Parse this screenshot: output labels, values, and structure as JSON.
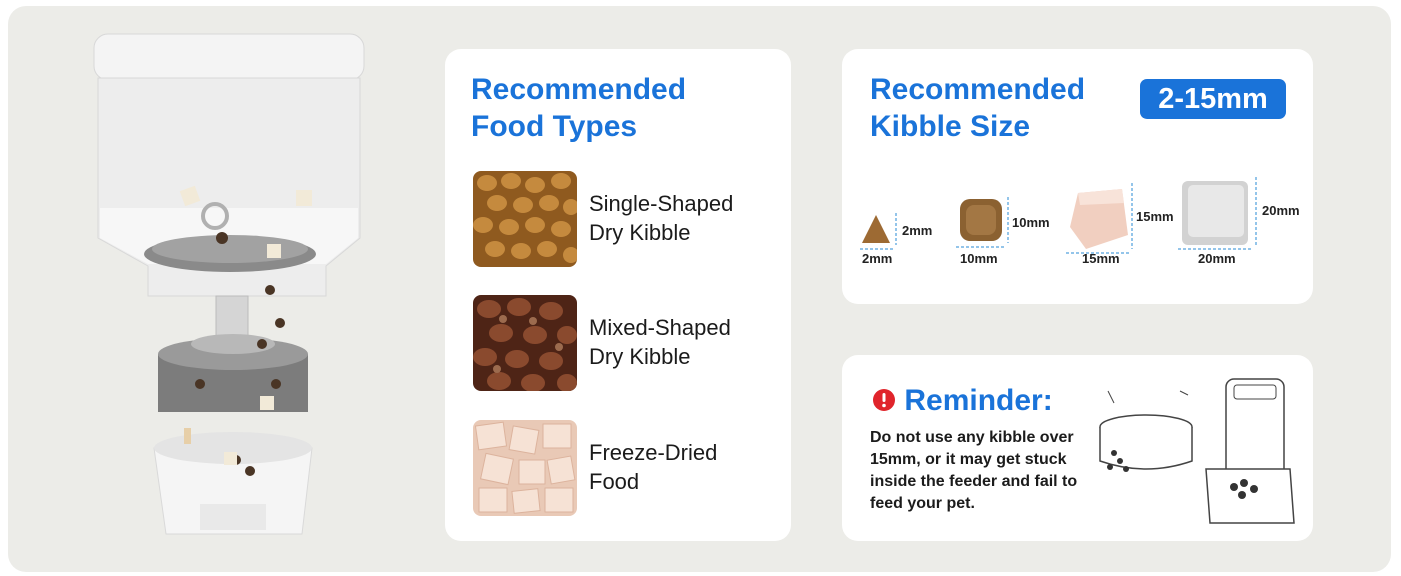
{
  "food_types": {
    "title_line1": "Recommended",
    "title_line2": "Food Types",
    "items": [
      {
        "line1": "Single-Shaped",
        "line2": "Dry Kibble"
      },
      {
        "line1": "Mixed-Shaped",
        "line2": "Dry Kibble"
      },
      {
        "line1": "Freeze-Dried",
        "line2": "Food"
      }
    ]
  },
  "kibble_size": {
    "title_line1": "Recommended",
    "title_line2": "Kibble Size",
    "badge": "2-15mm",
    "sizes": [
      {
        "height": "2mm",
        "width": "2mm"
      },
      {
        "height": "10mm",
        "width": "10mm"
      },
      {
        "height": "15mm",
        "width": "15mm"
      },
      {
        "height": "20mm",
        "width": "20mm"
      }
    ]
  },
  "reminder": {
    "title": "Reminder:",
    "icon": "exclamation-circle-icon",
    "text": "Do not use any kibble over 15mm, or it may get stuck inside the feeder and fail to feed your pet."
  },
  "colors": {
    "accent_blue": "#1a73d9",
    "warning_red": "#e0242b",
    "panel_bg": "#ecece8"
  }
}
